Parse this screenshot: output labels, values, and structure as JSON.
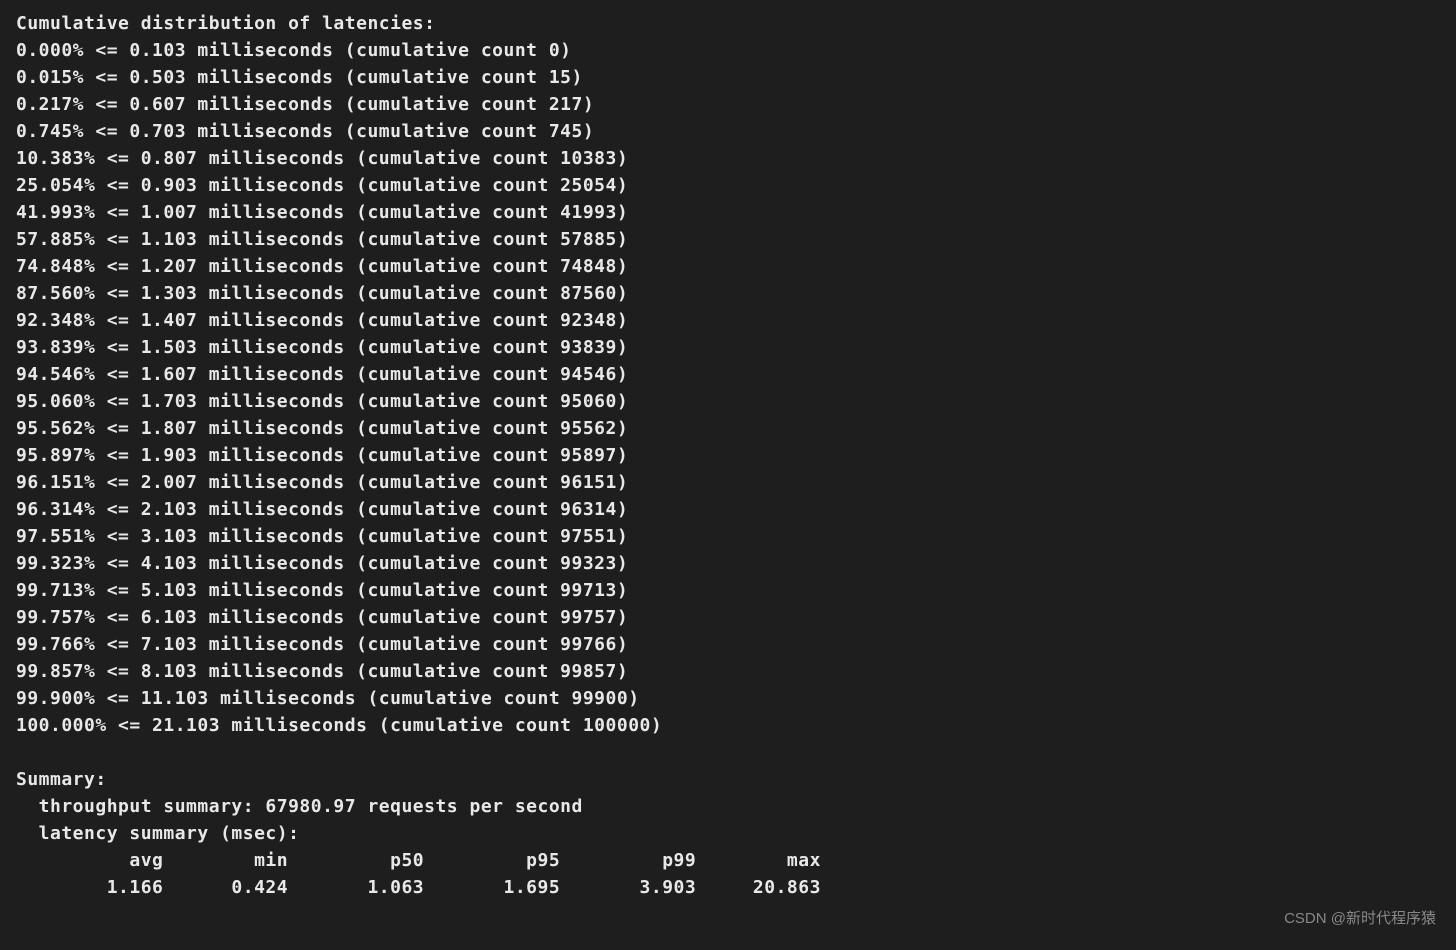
{
  "header": "Cumulative distribution of latencies:",
  "distribution": [
    {
      "percent": "0.000%",
      "ms": "0.103",
      "count": "0"
    },
    {
      "percent": "0.015%",
      "ms": "0.503",
      "count": "15"
    },
    {
      "percent": "0.217%",
      "ms": "0.607",
      "count": "217"
    },
    {
      "percent": "0.745%",
      "ms": "0.703",
      "count": "745"
    },
    {
      "percent": "10.383%",
      "ms": "0.807",
      "count": "10383"
    },
    {
      "percent": "25.054%",
      "ms": "0.903",
      "count": "25054"
    },
    {
      "percent": "41.993%",
      "ms": "1.007",
      "count": "41993"
    },
    {
      "percent": "57.885%",
      "ms": "1.103",
      "count": "57885"
    },
    {
      "percent": "74.848%",
      "ms": "1.207",
      "count": "74848"
    },
    {
      "percent": "87.560%",
      "ms": "1.303",
      "count": "87560"
    },
    {
      "percent": "92.348%",
      "ms": "1.407",
      "count": "92348"
    },
    {
      "percent": "93.839%",
      "ms": "1.503",
      "count": "93839"
    },
    {
      "percent": "94.546%",
      "ms": "1.607",
      "count": "94546"
    },
    {
      "percent": "95.060%",
      "ms": "1.703",
      "count": "95060"
    },
    {
      "percent": "95.562%",
      "ms": "1.807",
      "count": "95562"
    },
    {
      "percent": "95.897%",
      "ms": "1.903",
      "count": "95897"
    },
    {
      "percent": "96.151%",
      "ms": "2.007",
      "count": "96151"
    },
    {
      "percent": "96.314%",
      "ms": "2.103",
      "count": "96314"
    },
    {
      "percent": "97.551%",
      "ms": "3.103",
      "count": "97551"
    },
    {
      "percent": "99.323%",
      "ms": "4.103",
      "count": "99323"
    },
    {
      "percent": "99.713%",
      "ms": "5.103",
      "count": "99713"
    },
    {
      "percent": "99.757%",
      "ms": "6.103",
      "count": "99757"
    },
    {
      "percent": "99.766%",
      "ms": "7.103",
      "count": "99766"
    },
    {
      "percent": "99.857%",
      "ms": "8.103",
      "count": "99857"
    },
    {
      "percent": "99.900%",
      "ms": "11.103",
      "count": "99900"
    },
    {
      "percent": "100.000%",
      "ms": "21.103",
      "count": "100000"
    }
  ],
  "summary": {
    "title": "Summary:",
    "throughput_label": "  throughput summary: 67980.97 requests per second",
    "latency_label": "  latency summary (msec):",
    "headers": [
      "avg",
      "min",
      "p50",
      "p95",
      "p99",
      "max"
    ],
    "values": [
      "1.166",
      "0.424",
      "1.063",
      "1.695",
      "3.903",
      "20.863"
    ]
  },
  "watermark": "CSDN @新时代程序猿"
}
